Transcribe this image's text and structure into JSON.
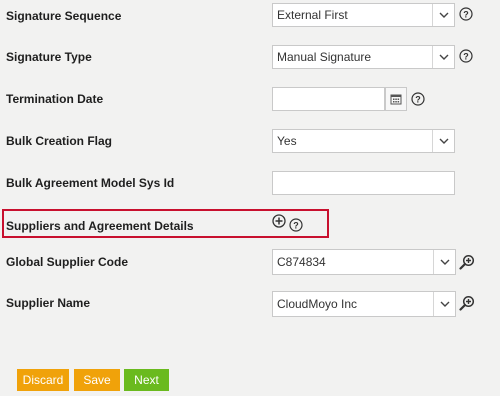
{
  "colors": {
    "background": "#f2f2f1",
    "highlight": "#c8102e",
    "discard": "#f0a20a",
    "save": "#f0a20a",
    "next": "#6aba1e"
  },
  "fields": {
    "signature_sequence": {
      "label": "Signature Sequence",
      "value": "External First"
    },
    "signature_type": {
      "label": "Signature Type",
      "value": "Manual Signature"
    },
    "termination_date": {
      "label": "Termination Date",
      "value": ""
    },
    "bulk_creation_flag": {
      "label": "Bulk Creation Flag",
      "value": "Yes"
    },
    "bulk_agreement_model": {
      "label": "Bulk Agreement Model Sys Id",
      "value": ""
    },
    "suppliers_section": {
      "label": "Suppliers and Agreement Details"
    },
    "global_supplier_code": {
      "label": "Global Supplier Code",
      "value": "C874834"
    },
    "supplier_name": {
      "label": "Supplier Name",
      "value": "CloudMoyo Inc"
    }
  },
  "buttons": {
    "discard": "Discard",
    "save": "Save",
    "next": "Next"
  },
  "icons": {
    "help": "question-circle-icon",
    "calendar": "calendar-icon",
    "add": "plus-circle-icon",
    "lookup": "magnifier-plus-icon",
    "dropdown": "chevron-down-icon"
  }
}
